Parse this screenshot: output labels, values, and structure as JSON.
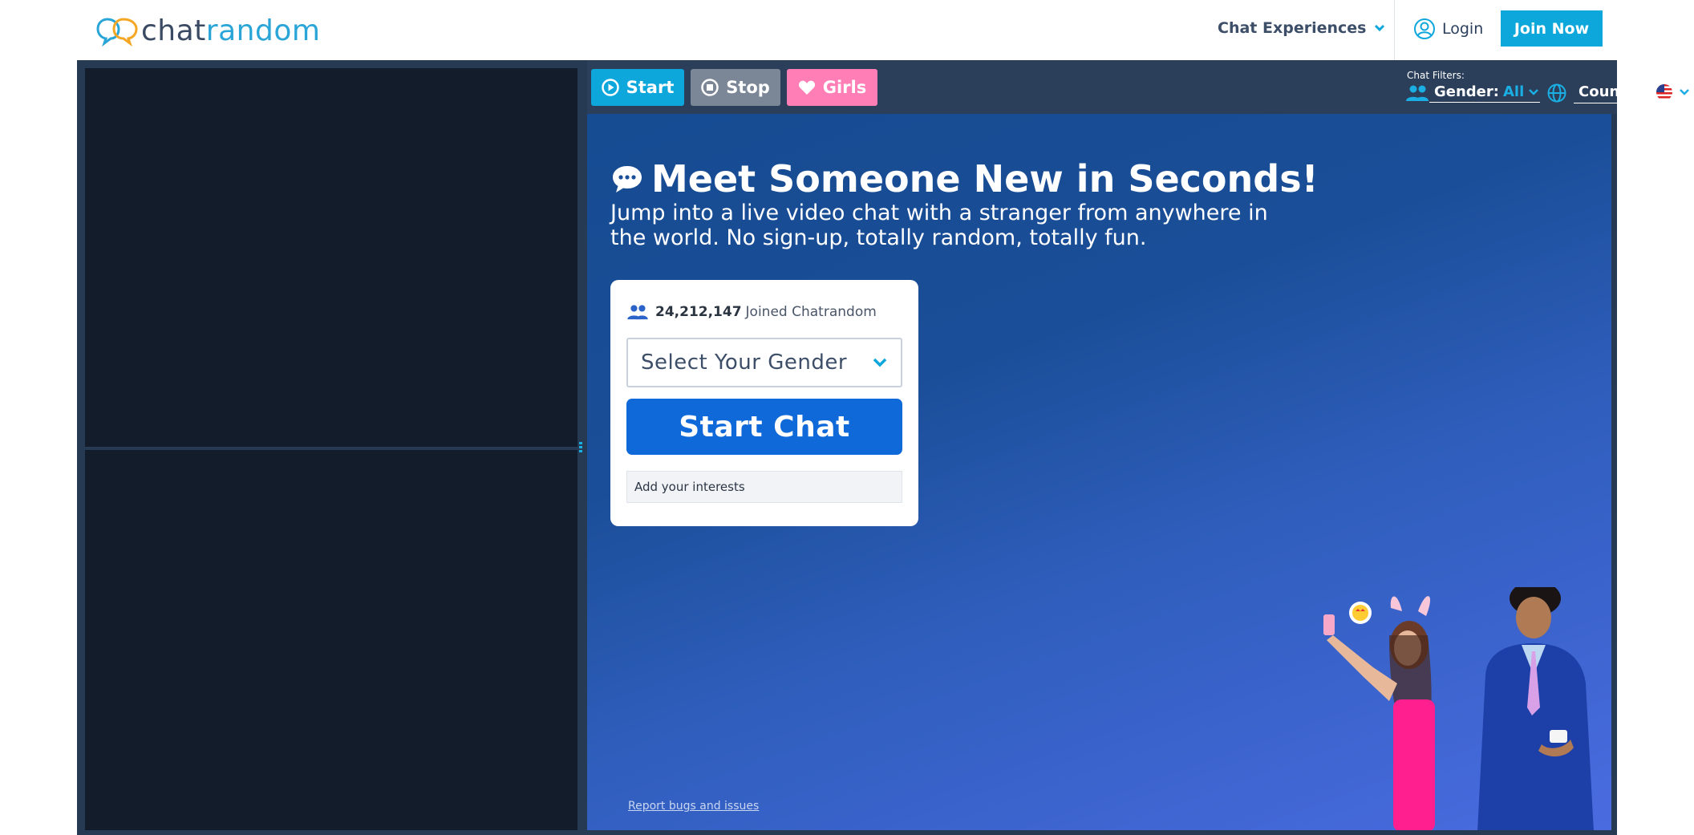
{
  "header": {
    "logo": {
      "text_main": "chat",
      "text_accent": "random"
    },
    "nav": {
      "experiences_label": "Chat Experiences"
    },
    "login_label": "Login",
    "join_label": "Join Now"
  },
  "toolbar": {
    "start_label": "Start",
    "stop_label": "Stop",
    "girls_label": "Girls",
    "filters": {
      "title": "Chat Filters:",
      "gender_label": "Gender:",
      "gender_value": "All",
      "country_label": "Country:",
      "country_flag": "us-flag-icon"
    }
  },
  "main": {
    "headline": "Meet Someone New in Seconds!",
    "subline": "Jump into a live video chat with a stranger from anywhere in the world. No sign-up, totally random, totally fun.",
    "card": {
      "joined_count": "24,212,147",
      "joined_text": "Joined Chatrandom",
      "gender_placeholder": "Select Your Gender",
      "start_chat_label": "Start Chat",
      "interests_placeholder": "Add your interests"
    },
    "report_link": "Report bugs and issues"
  },
  "colors": {
    "accent": "#0ea7dc",
    "start_chat": "#0f69d8",
    "girls": "#ff7eb6",
    "stop": "#7b8796",
    "frame": "#273a53",
    "video_bg": "#131c2b"
  }
}
